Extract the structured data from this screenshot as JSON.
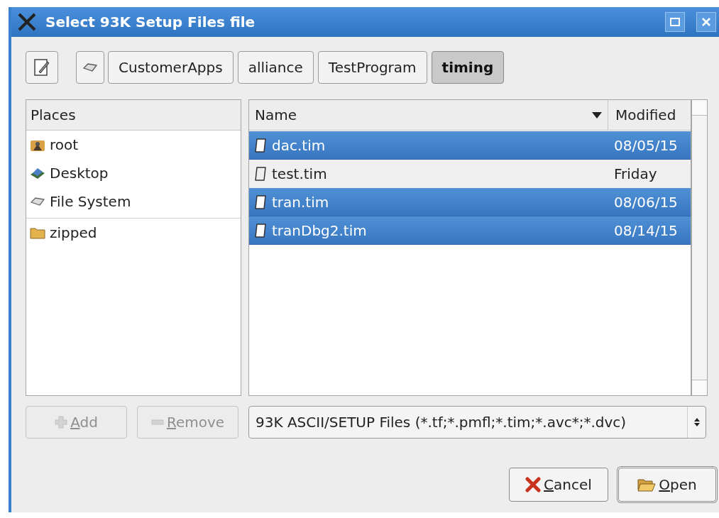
{
  "window": {
    "title": "Select 93K Setup Files file"
  },
  "path_bar": [
    {
      "label": "CustomerApps",
      "selected": false
    },
    {
      "label": "alliance",
      "selected": false
    },
    {
      "label": "TestProgram",
      "selected": false
    },
    {
      "label": "timing",
      "selected": true
    }
  ],
  "places": {
    "header": "Places",
    "items": [
      {
        "label": "root",
        "kind": "home"
      },
      {
        "label": "Desktop",
        "kind": "desktop"
      },
      {
        "label": "File System",
        "kind": "drive"
      },
      {
        "label": "zipped",
        "kind": "folder"
      }
    ]
  },
  "files": {
    "columns": [
      "Name",
      "Modified"
    ],
    "rows": [
      {
        "name": "dac.tim",
        "modified": "08/05/15",
        "selected": true
      },
      {
        "name": "test.tim",
        "modified": "Friday",
        "selected": false
      },
      {
        "name": "tran.tim",
        "modified": "08/06/15",
        "selected": true
      },
      {
        "name": "tranDbg2.tim",
        "modified": "08/14/15",
        "selected": true
      }
    ]
  },
  "add_button": {
    "label": "Add",
    "disabled": true
  },
  "remove_button": {
    "label": "Remove",
    "disabled": true
  },
  "filter": {
    "value": "93K ASCII/SETUP Files (*.tf;*.pmfl;*.tim;*.avc*;*.dvc)"
  },
  "buttons": [
    {
      "label": "Cancel",
      "kind": "cancel"
    },
    {
      "label": "Open",
      "kind": "open"
    }
  ]
}
